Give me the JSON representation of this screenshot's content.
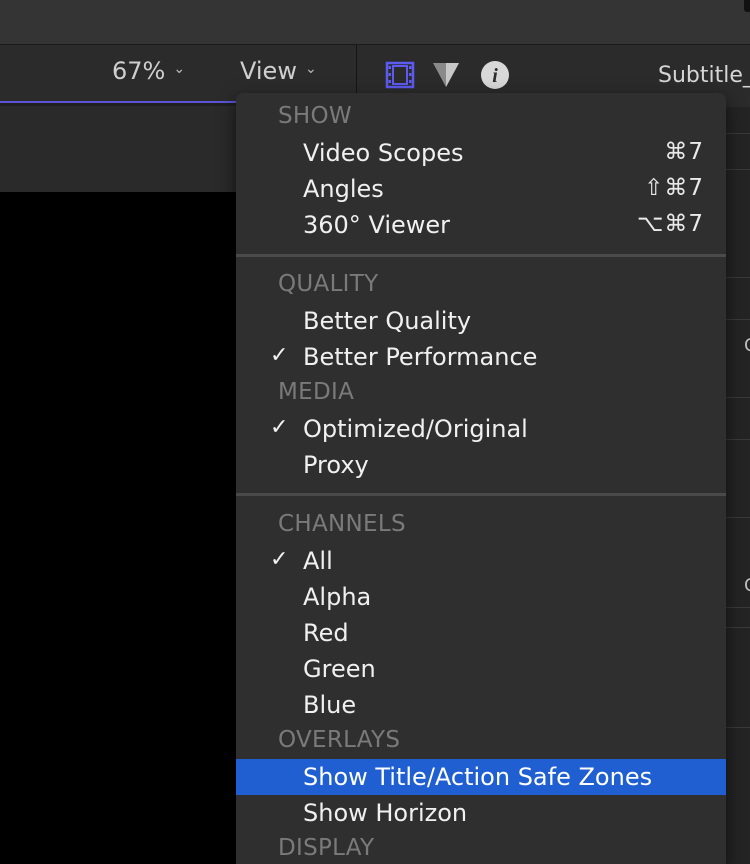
{
  "toolbar": {
    "zoom": "67%",
    "view": "View"
  },
  "inspector": {
    "title": "Subtitle_"
  },
  "colors": {
    "selection": "#1f5fd1",
    "accent": "#5b54d6"
  },
  "menu": {
    "sections": {
      "show": "SHOW",
      "quality": "QUALITY",
      "media": "MEDIA",
      "channels": "CHANNELS",
      "overlays": "OVERLAYS",
      "display": "DISPLAY"
    },
    "items": {
      "video_scopes": {
        "label": "Video Scopes",
        "shortcut": "⌘7"
      },
      "angles": {
        "label": "Angles",
        "shortcut": "⇧⌘7"
      },
      "viewer_360": {
        "label": "360° Viewer",
        "shortcut": "⌥⌘7"
      },
      "better_quality": {
        "label": "Better Quality"
      },
      "better_performance": {
        "label": "Better Performance",
        "check": "✓"
      },
      "optimized_original": {
        "label": "Optimized/Original",
        "check": "✓"
      },
      "proxy": {
        "label": "Proxy"
      },
      "all": {
        "label": "All",
        "check": "✓"
      },
      "alpha": {
        "label": "Alpha"
      },
      "red": {
        "label": "Red"
      },
      "green": {
        "label": "Green"
      },
      "blue": {
        "label": "Blue"
      },
      "safe_zones": {
        "label": "Show Title/Action Safe Zones"
      },
      "horizon": {
        "label": "Show Horizon"
      }
    }
  },
  "side_glyphs": [
    "C",
    "C"
  ]
}
